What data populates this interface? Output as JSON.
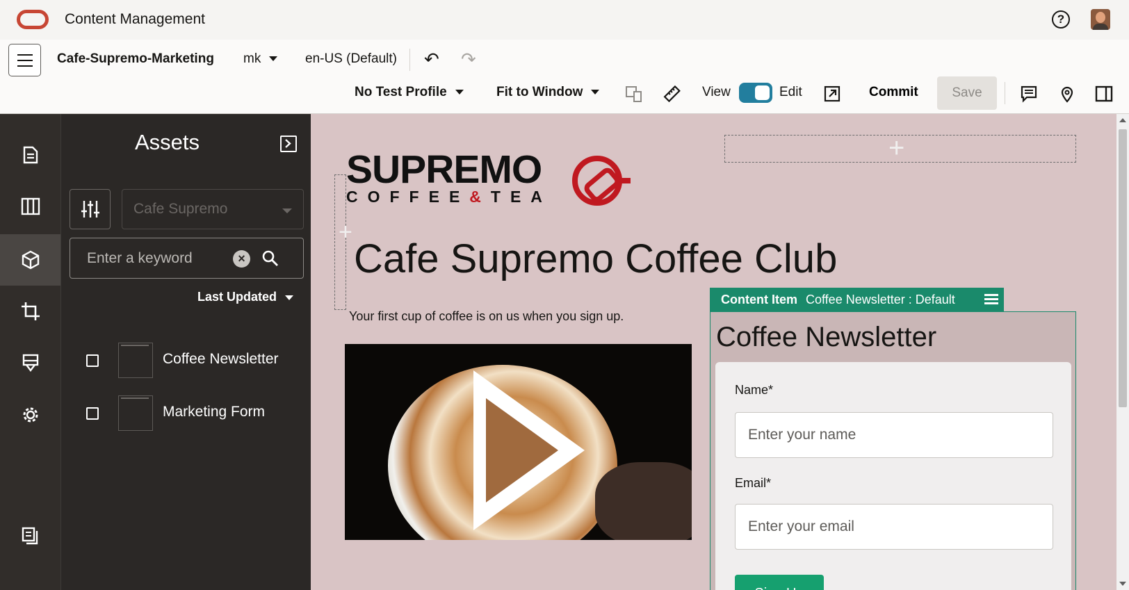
{
  "header": {
    "app_title": "Content Management"
  },
  "toolbar": {
    "site_name": "Cafe-Supremo-Marketing",
    "channel": "mk",
    "locale": "en-US (Default)",
    "test_profile": "No Test Profile",
    "zoom": "Fit to Window",
    "view_label": "View",
    "edit_label": "Edit",
    "commit_label": "Commit",
    "save_label": "Save",
    "mode_edit_on": true
  },
  "assets_panel": {
    "title": "Assets",
    "repository": "Cafe Supremo",
    "search_placeholder": "Enter a keyword",
    "sort_label": "Last Updated",
    "items": [
      {
        "label": "Coffee Newsletter"
      },
      {
        "label": "Marketing Form"
      }
    ]
  },
  "page": {
    "brand_word": "SUPREMO",
    "brand_sub_left": "COFFEE",
    "brand_sub_amp": "&",
    "brand_sub_right": "TEA",
    "hero_title": "Cafe Supremo Coffee Club",
    "subtitle": "Your first cup of coffee is on us when you sign up."
  },
  "content_item": {
    "type_label": "Content Item",
    "name": "Coffee Newsletter : Default",
    "title": "Coffee Newsletter",
    "name_label": "Name*",
    "name_placeholder": "Enter your name",
    "email_label": "Email*",
    "email_placeholder": "Enter your email",
    "submit_label": "Sign Up"
  },
  "colors": {
    "oracle_red": "#c74634",
    "rail_bg": "#312d2a",
    "panel_bg": "#2b2826",
    "canvas_bg": "#d9c4c5",
    "content_item_accent": "#1a8a6b",
    "toggle_on": "#227e9e"
  }
}
